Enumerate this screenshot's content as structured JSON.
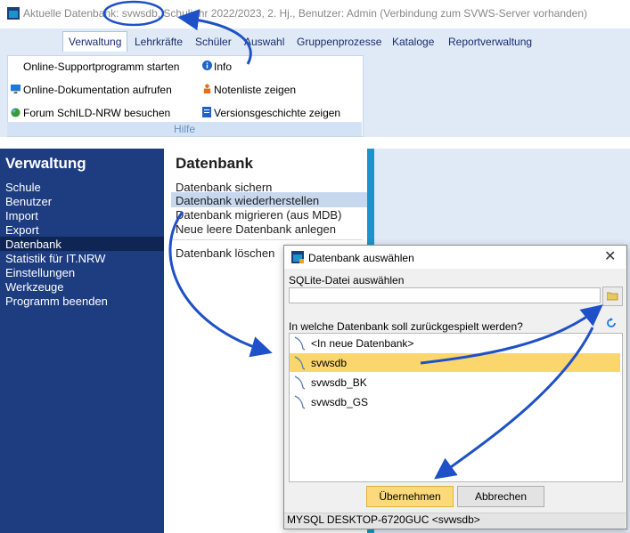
{
  "window": {
    "title": "Aktuelle Datenbank: svwsdb, Schuljahr 2022/2023, 2. Hj., Benutzer: Admin (Verbindung zum SVWS-Server vorhanden)"
  },
  "ribbon": {
    "tabs": [
      "Verwaltung",
      "Lehrkräfte",
      "Schüler",
      "Auswahl",
      "Gruppenprozesse",
      "Kataloge",
      "Reportverwaltung"
    ],
    "active_tab": "Verwaltung",
    "items": {
      "support": "Online-Supportprogramm starten",
      "info": "Info",
      "docs": "Online-Dokumentation aufrufen",
      "notenliste": "Notenliste zeigen",
      "forum": "Forum SchILD-NRW besuchen",
      "versions": "Versionsgeschichte zeigen"
    },
    "group_label": "Hilfe"
  },
  "sidebar": {
    "heading": "Verwaltung",
    "items": [
      "Schule",
      "Benutzer",
      "Import",
      "Export",
      "Datenbank",
      "Statistik für IT.NRW",
      "Einstellungen",
      "Werkzeuge",
      "Programm beenden"
    ],
    "selected": "Datenbank"
  },
  "middle": {
    "heading": "Datenbank",
    "items": [
      "Datenbank sichern",
      "Datenbank wiederherstellen",
      "Datenbank migrieren (aus MDB)",
      "Neue leere Datenbank anlegen",
      "Datenbank löschen"
    ],
    "selected": "Datenbank wiederherstellen"
  },
  "dialog": {
    "title": "Datenbank auswählen",
    "close_glyph": "✕",
    "sqlite_label": "SQLite-Datei auswählen",
    "sqlite_value": "",
    "restore_label": "In welche Datenbank soll zurückgespielt werden?",
    "databases": [
      "<In neue Datenbank>",
      "svwsdb",
      "svwsdb_BK",
      "svwsdb_GS"
    ],
    "selected_database": "svwsdb",
    "ok_label": "Übernehmen",
    "cancel_label": "Abbrechen",
    "status": "MYSQL   DESKTOP-6720GUC <svwsdb>"
  },
  "colors": {
    "sidebar_bg": "#1d3d80",
    "ribbon_bg": "#dfeaf6",
    "accent": "#1b94c9",
    "selection": "#fbd66d",
    "annotation_arrow": "#1e50c8"
  }
}
